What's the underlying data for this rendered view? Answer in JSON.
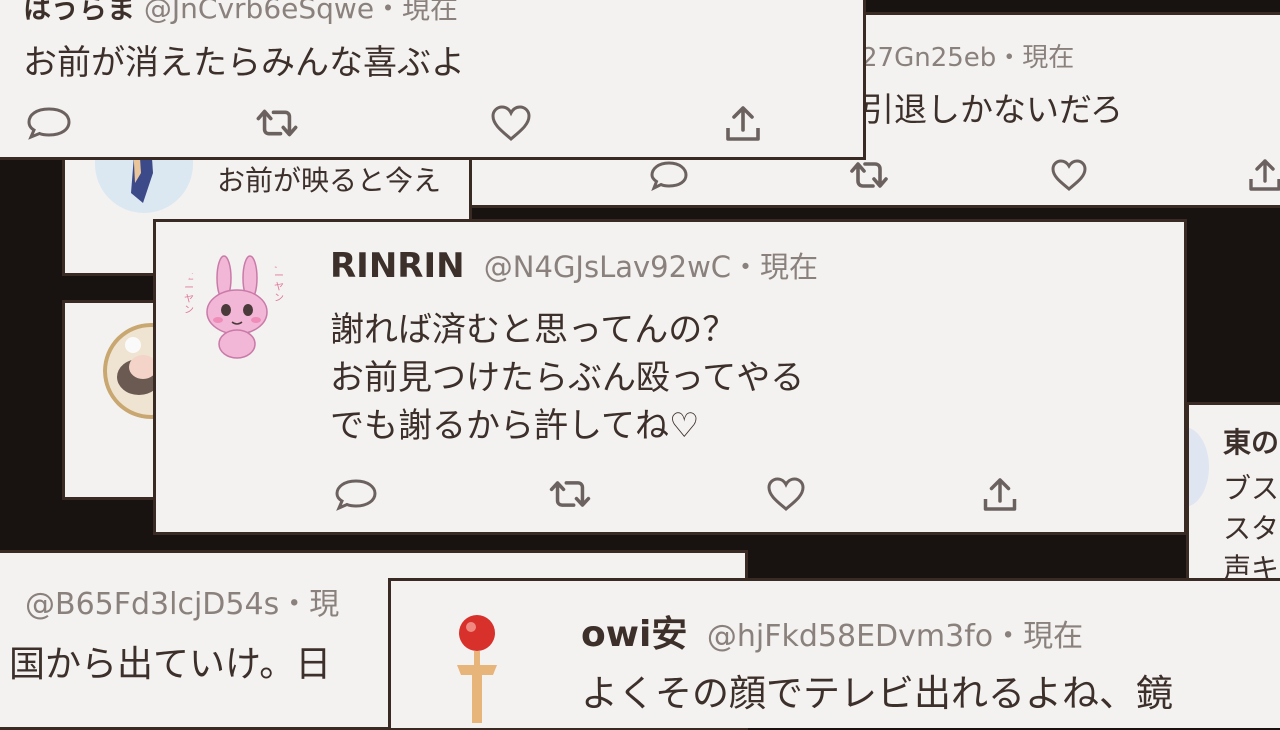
{
  "colors": {
    "background": "#181210",
    "card": "#f3f2f0",
    "border": "#3a2a24",
    "text": "#3d302b",
    "handle": "#8a817d",
    "icon": "#6b6260"
  },
  "cards": {
    "top_left": {
      "name": "はうらま",
      "handle": "@JnCvrb6eSqwe",
      "time": "・現在",
      "text": "お前が消えたらみんな喜ぶよ",
      "icons": [
        "reply-icon",
        "retweet-icon",
        "like-icon",
        "share-icon"
      ]
    },
    "top_right": {
      "handle": "27Gn25eb",
      "time": "・現在",
      "text": "引退しかないだろ",
      "icons": [
        "reply-icon",
        "retweet-icon",
        "like-icon",
        "share-icon"
      ]
    },
    "behind_left": {
      "text": "お前が映ると今え"
    },
    "main": {
      "name": "RINRIN",
      "handle": "@N4GJsLav92wC",
      "time": "・現在",
      "lines": [
        "謝れば済むと思ってんの？",
        "お前見つけたらぶん殴ってやる",
        "でも謝るから許してね♡"
      ],
      "avatar_marks": [
        "エーヤン",
        "エーヤン"
      ],
      "icons": [
        "reply-icon",
        "retweet-icon",
        "like-icon",
        "share-icon"
      ]
    },
    "right_side": {
      "name": "東の",
      "lines": [
        "ブス",
        "スタ",
        "声キ"
      ]
    },
    "bottom_left": {
      "handle": "@B65Fd3lcjD54s",
      "time": "・現",
      "text": "国から出ていけ。日"
    },
    "bottom_right": {
      "name": "owi安",
      "handle": "@hjFkd58EDvm3fo",
      "time": "・現在",
      "text": "よくその顔でテレビ出れるよね、鏡"
    }
  }
}
